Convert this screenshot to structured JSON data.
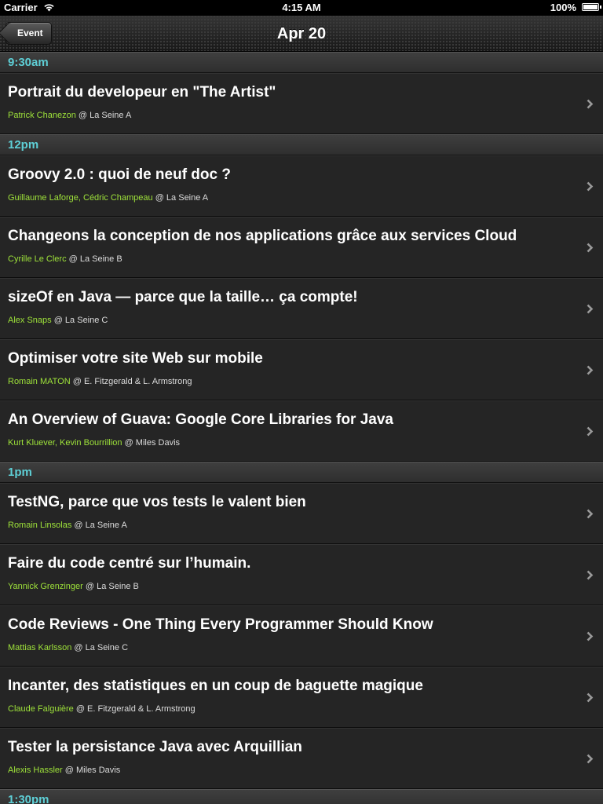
{
  "status_bar": {
    "carrier": "Carrier",
    "time": "4:15 AM",
    "battery": "100%"
  },
  "nav": {
    "back_label": "Event",
    "title": "Apr 20"
  },
  "sections": [
    {
      "time": "9:30am",
      "items": [
        {
          "title": "Portrait du developeur en \"The Artist\"",
          "speakers": "Patrick Chanezon",
          "room": " @ La Seine A"
        }
      ]
    },
    {
      "time": "12pm",
      "items": [
        {
          "title": "Groovy 2.0 : quoi de neuf doc ?",
          "speakers": "Guillaume Laforge, Cédric Champeau",
          "room": " @ La Seine A"
        },
        {
          "title": "Changeons la conception de nos applications grâce aux services Cloud",
          "speakers": "Cyrille Le Clerc",
          "room": " @ La Seine B"
        },
        {
          "title": "sizeOf en Java — parce que la taille… ça compte!",
          "speakers": "Alex Snaps",
          "room": " @ La Seine C"
        },
        {
          "title": "Optimiser votre site Web sur mobile",
          "speakers": "Romain MATON",
          "room": " @ E. Fitzgerald & L. Armstrong"
        },
        {
          "title": "An Overview of Guava: Google Core Libraries for Java",
          "speakers": "Kurt Kluever, Kevin Bourrillion",
          "room": " @ Miles Davis"
        }
      ]
    },
    {
      "time": "1pm",
      "items": [
        {
          "title": "TestNG, parce que vos tests le valent bien",
          "speakers": "Romain Linsolas",
          "room": " @ La Seine A"
        },
        {
          "title": "Faire du code centré sur l’humain.",
          "speakers": "Yannick Grenzinger",
          "room": " @ La Seine B"
        },
        {
          "title": "Code Reviews - One Thing Every Programmer Should Know",
          "speakers": "Mattias Karlsson",
          "room": " @ La Seine C"
        },
        {
          "title": "Incanter, des statistiques en un coup de baguette magique",
          "speakers": "Claude Falguière",
          "room": " @ E. Fitzgerald & L. Armstrong"
        },
        {
          "title": "Tester la persistance Java avec Arquillian",
          "speakers": "Alexis Hassler",
          "room": " @ Miles Davis"
        }
      ]
    },
    {
      "time": "1:30pm",
      "items": []
    }
  ]
}
